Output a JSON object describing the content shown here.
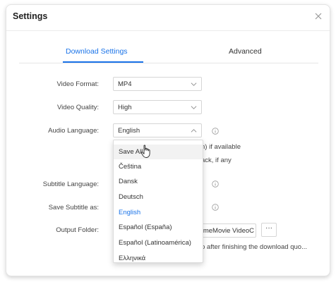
{
  "window": {
    "title": "Settings"
  },
  "tabs": [
    {
      "label": "Download Settings",
      "active": true
    },
    {
      "label": "Advanced",
      "active": false
    }
  ],
  "form": {
    "video_format": {
      "label": "Video Format:",
      "value": "MP4"
    },
    "video_quality": {
      "label": "Video Quality:",
      "value": "High"
    },
    "audio_language": {
      "label": "Audio Language:",
      "value": "English",
      "open": true
    },
    "subtitle_language": {
      "label": "Subtitle Language:"
    },
    "save_subtitle_as": {
      "label": "Save Subtitle as:"
    },
    "output_folder": {
      "label": "Output Folder:",
      "path_visible": "meMovie VideoC",
      "browse_label": "···"
    }
  },
  "partially_hidden_texts": {
    "line1": "n) if available",
    "line2": "ack, if any",
    "line3": "p after finishing the download quo..."
  },
  "dropdown": {
    "options": [
      "Save All",
      "Čeština",
      "Dansk",
      "Deutsch",
      "English",
      "Español (España)",
      "Español (Latinoamérica)",
      "Ελληνικά"
    ],
    "hovered": "Save All",
    "selected": "English"
  },
  "colors": {
    "accent": "#1a73e8",
    "border": "#d6d6d6",
    "hover": "#f2f2f2"
  },
  "icons": {
    "close": "close-icon",
    "chevron": "chevron-icon",
    "info": "info-icon",
    "cursor": "hand-cursor-icon"
  }
}
